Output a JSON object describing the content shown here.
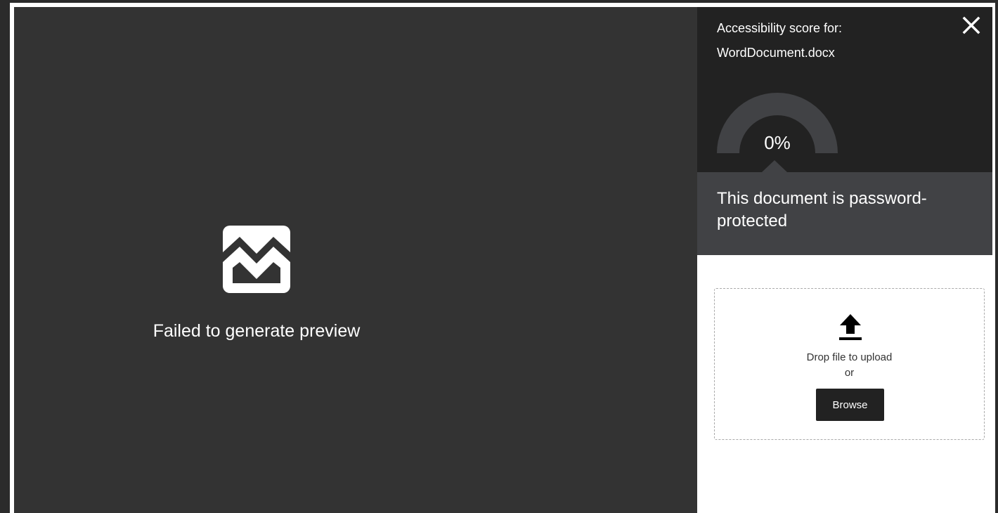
{
  "preview": {
    "message": "Failed to generate preview",
    "icon": "broken-image-icon"
  },
  "panel": {
    "score_label": "Accessibility score for:",
    "file_name": "WordDocument.docx",
    "score_value": "0%",
    "score_fraction": 0,
    "status_message": "This document is password-protected",
    "close_icon": "close-icon"
  },
  "upload": {
    "icon": "upload-icon",
    "drop_text": "Drop file to upload",
    "or_text": "or",
    "browse_label": "Browse"
  },
  "colors": {
    "preview_bg": "#333333",
    "score_header_bg": "#222222",
    "status_bg": "#414245",
    "gauge_track": "#414245",
    "button_bg": "#222222"
  }
}
